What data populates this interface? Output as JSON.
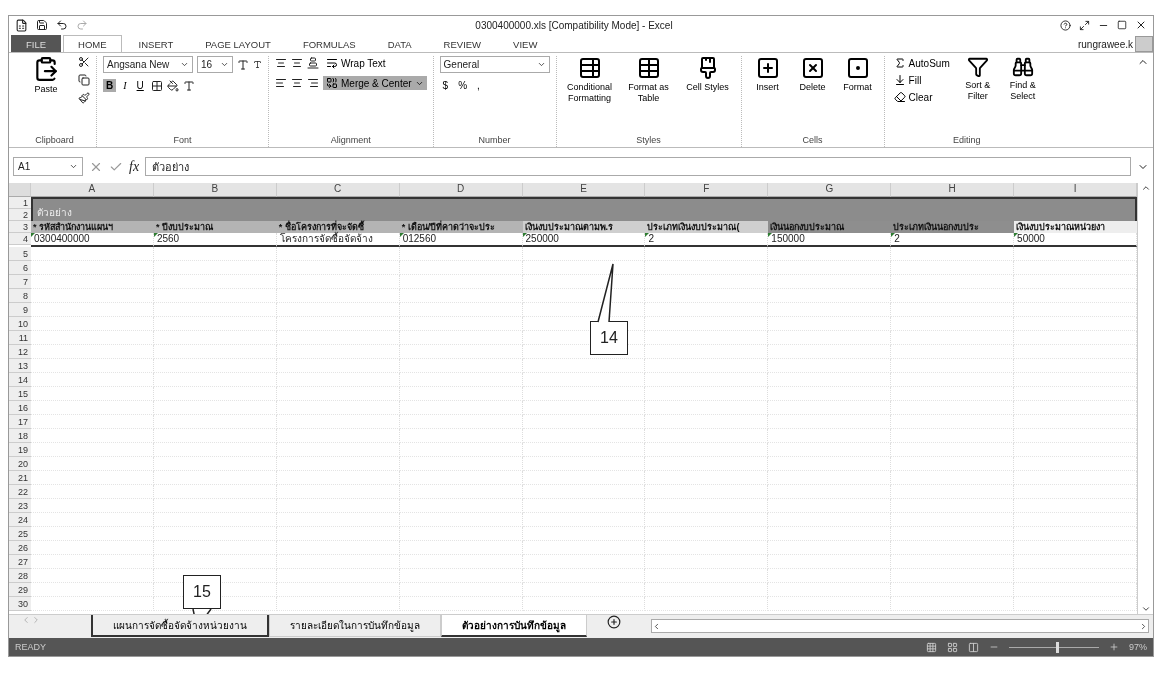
{
  "window": {
    "title": "0300400000.xls  [Compatibility Mode] - Excel",
    "user": "rungrawee.k"
  },
  "ribbon_tabs": [
    {
      "label": "FILE",
      "kind": "file",
      "selected": false
    },
    {
      "label": "HOME",
      "kind": "tab",
      "selected": true
    },
    {
      "label": "INSERT",
      "kind": "tab",
      "selected": false
    },
    {
      "label": "PAGE LAYOUT",
      "kind": "tab",
      "selected": false
    },
    {
      "label": "FORMULAS",
      "kind": "tab",
      "selected": false
    },
    {
      "label": "DATA",
      "kind": "tab",
      "selected": false
    },
    {
      "label": "REVIEW",
      "kind": "tab",
      "selected": false
    },
    {
      "label": "VIEW",
      "kind": "tab",
      "selected": false
    }
  ],
  "ribbon": {
    "clipboard": {
      "title": "Clipboard",
      "paste": "Paste"
    },
    "font": {
      "title": "Font",
      "name": "Angsana New",
      "size": "16",
      "bold_label": "B",
      "italic_label": "I",
      "underline_label": "U",
      "bold": true
    },
    "alignment": {
      "title": "Alignment",
      "wrap_text": "Wrap Text",
      "merge_center": "Merge & Center",
      "merge_on": true
    },
    "number": {
      "title": "Number",
      "format": "General",
      "currency": "$",
      "percent": "%",
      "comma": ","
    },
    "styles": {
      "title": "Styles",
      "buttons": [
        "Conditional Formatting",
        "Format as Table",
        "Cell Styles"
      ]
    },
    "cells": {
      "title": "Cells",
      "buttons": [
        "Insert",
        "Delete",
        "Format"
      ]
    },
    "editing": {
      "title": "Editing",
      "autosum": "AutoSum",
      "fill": "Fill",
      "clear": "Clear",
      "sort": "Sort & Filter",
      "find": "Find & Select"
    }
  },
  "formula_bar": {
    "name_box": "A1",
    "fx": "fx",
    "content": "ตัวอย่าง"
  },
  "sheet": {
    "columns": [
      "A",
      "B",
      "C",
      "D",
      "E",
      "F",
      "G",
      "H",
      "I"
    ],
    "row_numbers": [
      "1",
      "2",
      "3",
      "4",
      "5",
      "6",
      "7",
      "8",
      "9",
      "10",
      "11",
      "12",
      "13",
      "14",
      "15",
      "16",
      "17",
      "18",
      "19",
      "20",
      "21",
      "22",
      "23",
      "24",
      "25",
      "26",
      "27",
      "28",
      "29",
      "30"
    ],
    "title_cell": "ตัวอย่าง",
    "headers": [
      {
        "text": "* รหัสสำนักงานแผนฯ",
        "color": "#b4b4b4"
      },
      {
        "text": "* ปีงบประมาณ",
        "color": "#b4b4b4"
      },
      {
        "text": "* ชื่อโครงการที่จะจัดซื้",
        "color": "#b4b4b4"
      },
      {
        "text": "* เดือน/ปีที่คาดว่าจะประ",
        "color": "#b4b4b4"
      },
      {
        "text": "เงินงบประมาณตามพ.ร",
        "color": "#cfcfcf"
      },
      {
        "text": "ประเภทเงินงบประมาณ(",
        "color": "#cfcfcf"
      },
      {
        "text": "เงินนอกงบประมาณ",
        "color": "#8e8e8e"
      },
      {
        "text": "ประเภทเงินนอกงบประ",
        "color": "#8e8e8e"
      },
      {
        "text": "เงินงบประมาณหน่วยงา",
        "color": "#eeeeee"
      }
    ],
    "data": [
      {
        "text": "0300400000",
        "error_mark": true
      },
      {
        "text": "2560",
        "error_mark": true
      },
      {
        "text": "โครงการจัดซื้อจัดจ้าง",
        "error_mark": false
      },
      {
        "text": "012560",
        "error_mark": true
      },
      {
        "text": "250000",
        "error_mark": true
      },
      {
        "text": "2",
        "error_mark": true
      },
      {
        "text": "150000",
        "error_mark": true
      },
      {
        "text": "2",
        "error_mark": true
      },
      {
        "text": "50000",
        "error_mark": true
      }
    ]
  },
  "callouts": [
    {
      "label": "14"
    },
    {
      "label": "15"
    }
  ],
  "sheet_tabs": [
    {
      "label": "แผนการจัดซื้อจัดจ้างหน่วยงาน",
      "selected": false,
      "highlighted": true
    },
    {
      "label": "รายละเอียดในการบันทึกข้อมูล",
      "selected": false,
      "highlighted": false
    },
    {
      "label": "ตัวอย่างการบันทึกข้อมูล",
      "selected": true,
      "highlighted": false
    }
  ],
  "status_bar": {
    "mode": "READY",
    "zoom": "97%",
    "zoom_slider": {
      "level": 0.55
    }
  }
}
